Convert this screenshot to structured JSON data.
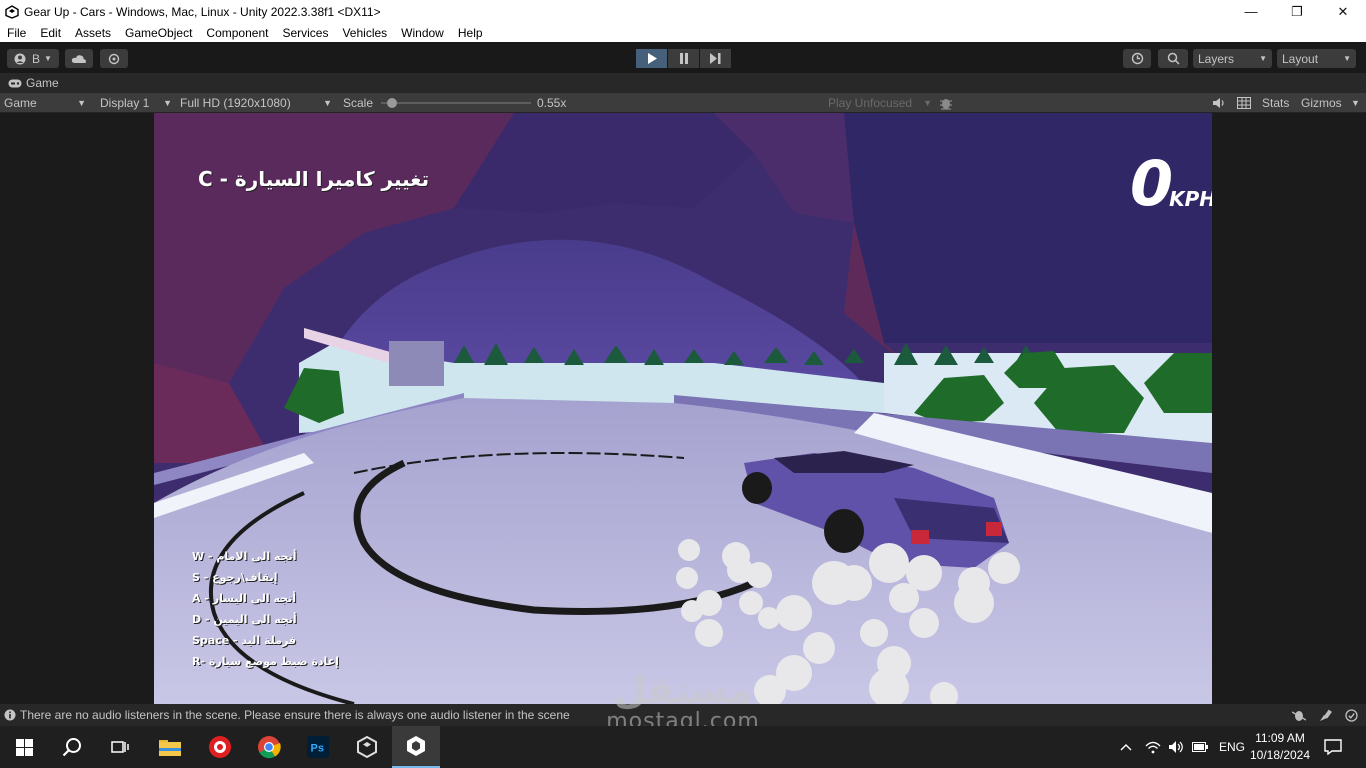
{
  "window": {
    "title": "Gear Up - Cars - Windows, Mac, Linux - Unity 2022.3.38f1 <DX11>",
    "minimize": "—",
    "maximize": "❐",
    "close": "✕"
  },
  "menu": [
    "File",
    "Edit",
    "Assets",
    "GameObject",
    "Component",
    "Services",
    "Vehicles",
    "Window",
    "Help"
  ],
  "toolbar": {
    "account_label": "B",
    "layers_label": "Layers",
    "layout_label": "Layout"
  },
  "tab": {
    "label": "Game"
  },
  "gamebar": {
    "view_select": "Game",
    "display_select": "Display 1",
    "resolution_select": "Full HD (1920x1080)",
    "scale_label": "Scale",
    "scale_value": "0.55x",
    "scale_fraction": 0.04,
    "play_focus": "Play Unfocused",
    "stats_label": "Stats",
    "gizmos_label": "Gizmos"
  },
  "hud": {
    "camera_hint": "تغيير كاميرا السيارة - C",
    "speed_value": "0",
    "speed_unit": "KPH",
    "controls": [
      "W - أتجه الى الامام",
      "S - إيقاف\\رجوع",
      "A - أتجه الى اليسار",
      "D - أتجه الى اليمين",
      "Space - فرملة اليد",
      "R- إعادة ضبط موضع سيارة"
    ]
  },
  "status": {
    "message": "There are no audio listeners in the scene. Please ensure there is always one audio listener in the scene"
  },
  "watermark": {
    "arabic": "مستقل",
    "latin": "mostaql.com"
  },
  "taskbar": {
    "language": "ENG",
    "time": "11:09 AM",
    "date": "10/18/2024"
  }
}
